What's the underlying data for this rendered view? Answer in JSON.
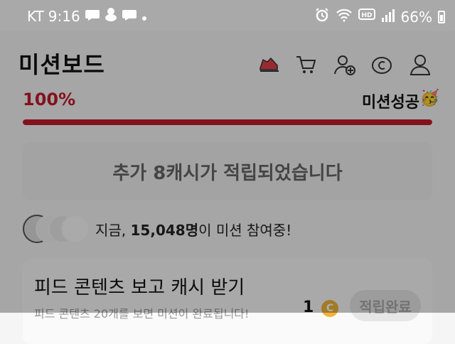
{
  "status_bar": {
    "carrier": "KT",
    "time": "9:16",
    "battery_percent": "66%",
    "hd_label": "HD"
  },
  "app_bar": {
    "title": "미션보드",
    "icons": [
      "shoe-icon",
      "cart-icon",
      "add-user-icon",
      "copyright-coin-icon",
      "profile-icon"
    ]
  },
  "mission": {
    "progress_percent": "100%",
    "progress_value": 1.0,
    "status_label": "미션성공",
    "status_emoji": "🥳"
  },
  "reward_banner": {
    "text": "추가 8캐시가 적립되었습니다"
  },
  "participants": {
    "prefix": "지금, ",
    "count": "15,048명",
    "suffix": "이 미션 참여중!"
  },
  "task_card": {
    "title": "피드 콘텐츠 보고 캐시 받기",
    "subtitle": "피드 콘텐츠 20개를 보면 미션이 완료됩니다!",
    "reward_amount": "1",
    "coin_symbol": "C",
    "button_label": "적립완료"
  },
  "colors": {
    "accent": "#c11b2d",
    "coin": "#f0b43a"
  }
}
